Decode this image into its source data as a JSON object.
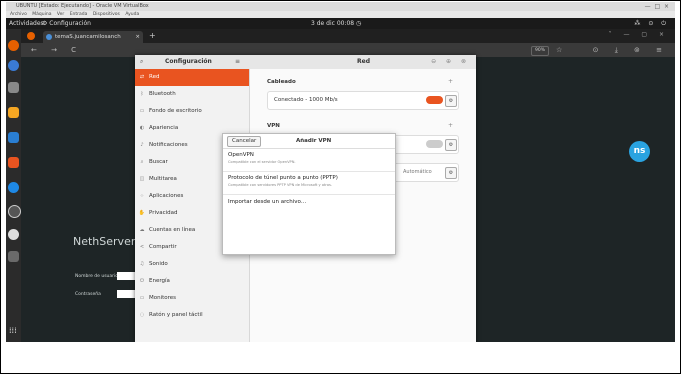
{
  "vm": {
    "title": "UBUNTU [Estado: Ejecutando] - Oracle VM VirtualBox",
    "menu": [
      "Archivo",
      "Máquina",
      "Ver",
      "Entrada",
      "Dispositivos",
      "Ayuda"
    ]
  },
  "topbar": {
    "activities": "Actividades",
    "app": "Configuración",
    "clock": "3 de dic 00:08"
  },
  "browser": {
    "tab_title": "temaS.juancamilosanch",
    "zoom": "90%"
  },
  "page": {
    "heading": "NethServer 7.9",
    "user_label": "Nombre de usuario",
    "password_label": "Contraseña",
    "logo_text": "ns"
  },
  "settings": {
    "left_title": "Configuración",
    "right_title": "Red",
    "sidebar": [
      {
        "label": "Red",
        "icon": "network-icon",
        "glyph": "⇄"
      },
      {
        "label": "Bluetooth",
        "icon": "bluetooth-icon",
        "glyph": "ᛒ"
      },
      {
        "label": "Fondo de escritorio",
        "icon": "wallpaper-icon",
        "glyph": "▭"
      },
      {
        "label": "Apariencia",
        "icon": "appearance-icon",
        "glyph": "◐"
      },
      {
        "label": "Notificaciones",
        "icon": "bell-icon",
        "glyph": "♪"
      },
      {
        "label": "Buscar",
        "icon": "search-icon",
        "glyph": "⌕"
      },
      {
        "label": "Multitarea",
        "icon": "multitask-icon",
        "glyph": "◫"
      },
      {
        "label": "Aplicaciones",
        "icon": "apps-icon",
        "glyph": "⁘"
      },
      {
        "label": "Privacidad",
        "icon": "privacy-icon",
        "glyph": "✋"
      },
      {
        "label": "Cuentas en línea",
        "icon": "cloud-icon",
        "glyph": "☁"
      },
      {
        "label": "Compartir",
        "icon": "share-icon",
        "glyph": "<"
      },
      {
        "label": "Sonido",
        "icon": "sound-icon",
        "glyph": "♫"
      },
      {
        "label": "Energía",
        "icon": "power-icon",
        "glyph": "⏻"
      },
      {
        "label": "Monitores",
        "icon": "monitor-icon",
        "glyph": "▭"
      },
      {
        "label": "Ratón y panel táctil",
        "icon": "mouse-icon",
        "glyph": "◌"
      }
    ],
    "wired": {
      "heading": "Cableado",
      "status": "Conectado - 1000 Mb/s"
    },
    "vpn": {
      "heading": "VPN"
    },
    "proxy": {
      "value": "Automático"
    }
  },
  "dialog": {
    "cancel": "Cancelar",
    "title": "Añadir VPN",
    "options": [
      {
        "name": "OpenVPN",
        "desc": "Compatible con el servidor OpenVPN."
      },
      {
        "name": "Protocolo de túnel punto a punto (PPTP)",
        "desc": "Compatible con servidores PPTP VPN de Microsoft y otros."
      },
      {
        "name": "Importar desde un archivo…",
        "desc": ""
      }
    ]
  },
  "colors": {
    "accent": "#e95420",
    "desktop": "#1e2526",
    "dock": "#2b2b2b"
  }
}
